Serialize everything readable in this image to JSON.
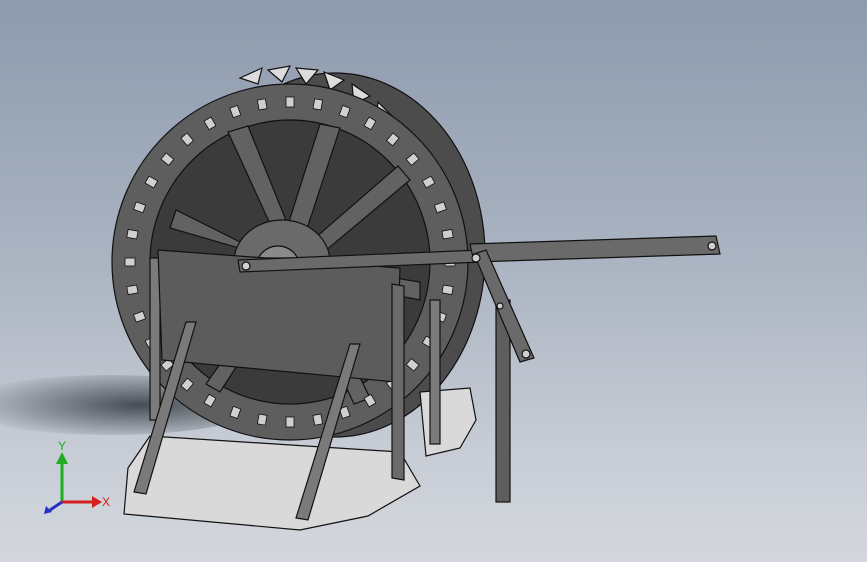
{
  "viewport": {
    "background_top": "#8e9bad",
    "background_bottom": "#d4d7dd",
    "model_color": "#5e5e5e",
    "edge_color": "#111111",
    "base_color": "#d9d9d9"
  },
  "triad": {
    "x_label": "X",
    "y_label": "Y",
    "x_color": "#d62020",
    "y_color": "#1fae1f",
    "z_color": "#2030c8"
  }
}
